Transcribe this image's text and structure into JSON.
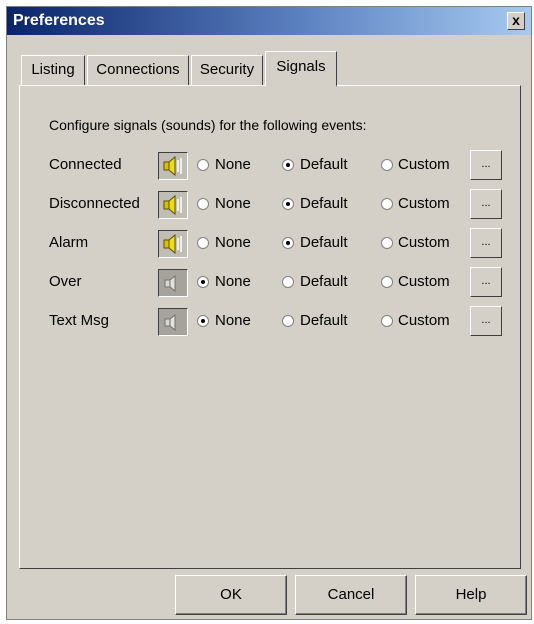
{
  "window": {
    "title": "Preferences",
    "close_label": "x"
  },
  "tabs": [
    {
      "label": "Listing",
      "active": false
    },
    {
      "label": "Connections",
      "active": false
    },
    {
      "label": "Security",
      "active": false
    },
    {
      "label": "Signals",
      "active": true
    }
  ],
  "panel": {
    "description": "Configure signals (sounds) for the following events:",
    "options": [
      "None",
      "Default",
      "Custom"
    ],
    "browse_label": "...",
    "events": [
      {
        "label": "Connected",
        "selected": "Default",
        "sound_icon": "speaker-on-icon"
      },
      {
        "label": "Disconnected",
        "selected": "Default",
        "sound_icon": "speaker-on-icon"
      },
      {
        "label": "Alarm",
        "selected": "Default",
        "sound_icon": "speaker-on-icon"
      },
      {
        "label": "Over",
        "selected": "None",
        "sound_icon": "speaker-off-icon"
      },
      {
        "label": "Text Msg",
        "selected": "None",
        "sound_icon": "speaker-off-icon"
      }
    ]
  },
  "buttons": {
    "ok": "OK",
    "cancel": "Cancel",
    "help": "Help"
  },
  "colors": {
    "title_start": "#0a246a",
    "title_end": "#a6caf0",
    "face": "#d4d0c8",
    "speaker_on": "#e8d000"
  }
}
